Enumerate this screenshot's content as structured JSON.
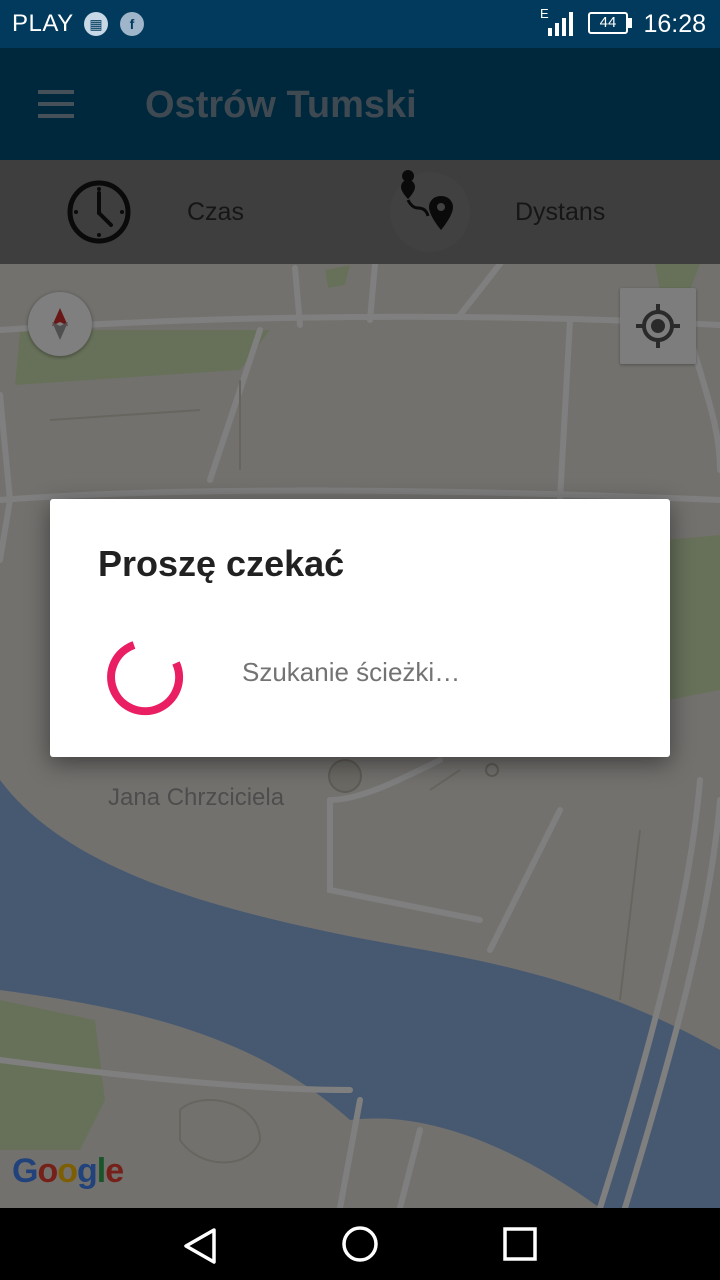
{
  "status_bar": {
    "carrier": "PLAY",
    "network_type": "E",
    "battery": "44",
    "time": "16:28",
    "icons": [
      "calendar-icon",
      "facebook-icon",
      "signal-icon",
      "battery-icon"
    ]
  },
  "app_bar": {
    "title": "Ostrów Tumski",
    "menu_icon": "hamburger-menu-icon"
  },
  "filters": {
    "time_label": "Czas",
    "distance_label": "Dystans",
    "time_icon": "clock-icon",
    "distance_icon": "route-pins-icon"
  },
  "map": {
    "labels": [
      "Jana Chrzciciela"
    ],
    "attribution": "Google",
    "compass_icon": "compass-icon",
    "locate_icon": "my-location-icon"
  },
  "dialog": {
    "title": "Proszę czekać",
    "message": "Szukanie ścieżki…",
    "spinner_color": "#e91e63"
  },
  "nav_bar": {
    "icons": [
      "back-icon",
      "home-icon",
      "recents-icon"
    ]
  },
  "colors": {
    "status_bar": "#013a5c",
    "app_bar": "#01507a",
    "accent": "#e91e63"
  }
}
